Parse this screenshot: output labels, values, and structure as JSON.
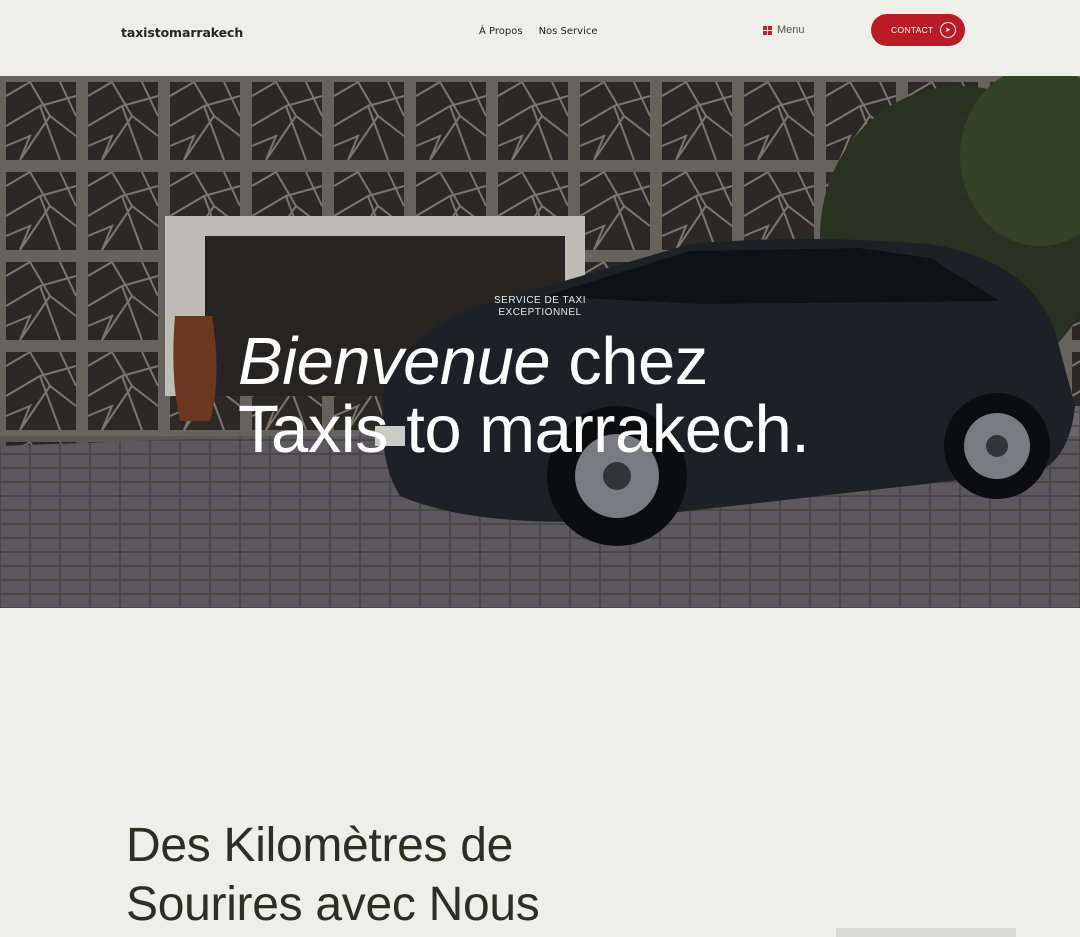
{
  "header": {
    "logo": "taxistomarrakech",
    "nav": [
      {
        "label": "À Propos"
      },
      {
        "label": "Nos Service"
      }
    ],
    "menu_label": "Menu",
    "contact_label": "CONTACT"
  },
  "hero": {
    "eyebrow_line1": "SERVICE DE TAXI",
    "eyebrow_line2": "EXCEPTIONNEL",
    "title_italic": "Bienvenue",
    "title_rest": " chez",
    "title_line2": "Taxis to marrakech."
  },
  "section": {
    "title_line1": "Des Kilomètres de",
    "title_line2": "Sourires avec Nous"
  },
  "colors": {
    "accent": "#b91c27",
    "background": "#efefea",
    "heading": "#2c2f22"
  },
  "icons": {
    "menu": "grid-icon",
    "contact": "arrow-circle-icon"
  }
}
